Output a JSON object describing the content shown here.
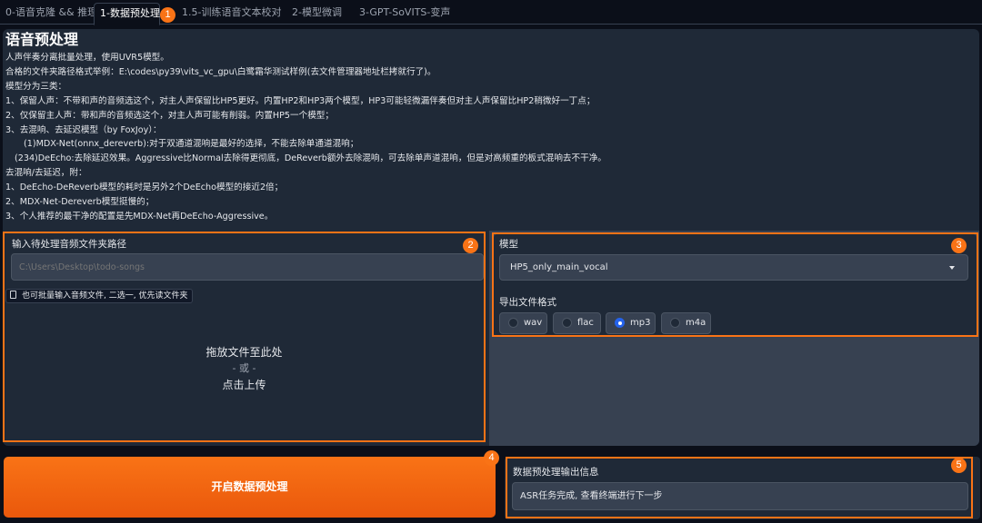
{
  "tabs": [
    {
      "label": "0-语音克隆 && 推理"
    },
    {
      "label": "1-数据预处理"
    },
    {
      "label": "1.5-训练语音文本校对"
    },
    {
      "label": "2-模型微调"
    },
    {
      "label": "3-GPT-SoVITS-变声"
    }
  ],
  "intro": {
    "title": "语音预处理",
    "lines": [
      "人声伴奏分离批量处理，使用UVR5模型。",
      "合格的文件夹路径格式举例：E:\\codes\\py39\\vits_vc_gpu\\白鹭霜华测试样例(去文件管理器地址栏拷就行了)。",
      "模型分为三类：",
      "1、保留人声：不带和声的音频选这个，对主人声保留比HP5更好。内置HP2和HP3两个模型，HP3可能轻微漏伴奏但对主人声保留比HP2稍微好一丁点；",
      "2、仅保留主人声：带和声的音频选这个，对主人声可能有削弱。内置HP5一个模型；",
      "3、去混响、去延迟模型（by FoxJoy）：",
      "(1)MDX-Net(onnx_dereverb):对于双通道混响是最好的选择，不能去除单通道混响；",
      "(234)DeEcho:去除延迟效果。Aggressive比Normal去除得更彻底，DeReverb额外去除混响，可去除单声道混响，但是对高频重的板式混响去不干净。",
      "去混响/去延迟，附：",
      "1、DeEcho-DeReverb模型的耗时是另外2个DeEcho模型的接近2倍；",
      "2、MDX-Net-Dereverb模型挺慢的；",
      "3、个人推荐的最干净的配置是先MDX-Net再DeEcho-Aggressive。"
    ]
  },
  "input_panel": {
    "label": "输入待处理音频文件夹路径",
    "placeholder": "C:\\Users\\Desktop\\todo-songs",
    "file_hint": "也可批量输入音频文件, 二选一, 优先读文件夹",
    "drop_line1": "拖放文件至此处",
    "drop_line2": "- 或 -",
    "drop_line3": "点击上传"
  },
  "model_panel": {
    "model_label": "模型",
    "model_value": "HP5_only_main_vocal",
    "format_label": "导出文件格式",
    "formats": [
      "wav",
      "flac",
      "mp3",
      "m4a"
    ],
    "selected_format": "mp3"
  },
  "start_button": "开启数据预处理",
  "output": {
    "label": "数据预处理输出信息",
    "value": "ASR任务完成, 查看终端进行下一步"
  },
  "annotations": [
    "1",
    "2",
    "3",
    "4",
    "5"
  ],
  "colors": {
    "accent": "#f97316",
    "radio_selected": "#2563eb",
    "background": "#0b0f19",
    "panel": "#1f2937"
  }
}
